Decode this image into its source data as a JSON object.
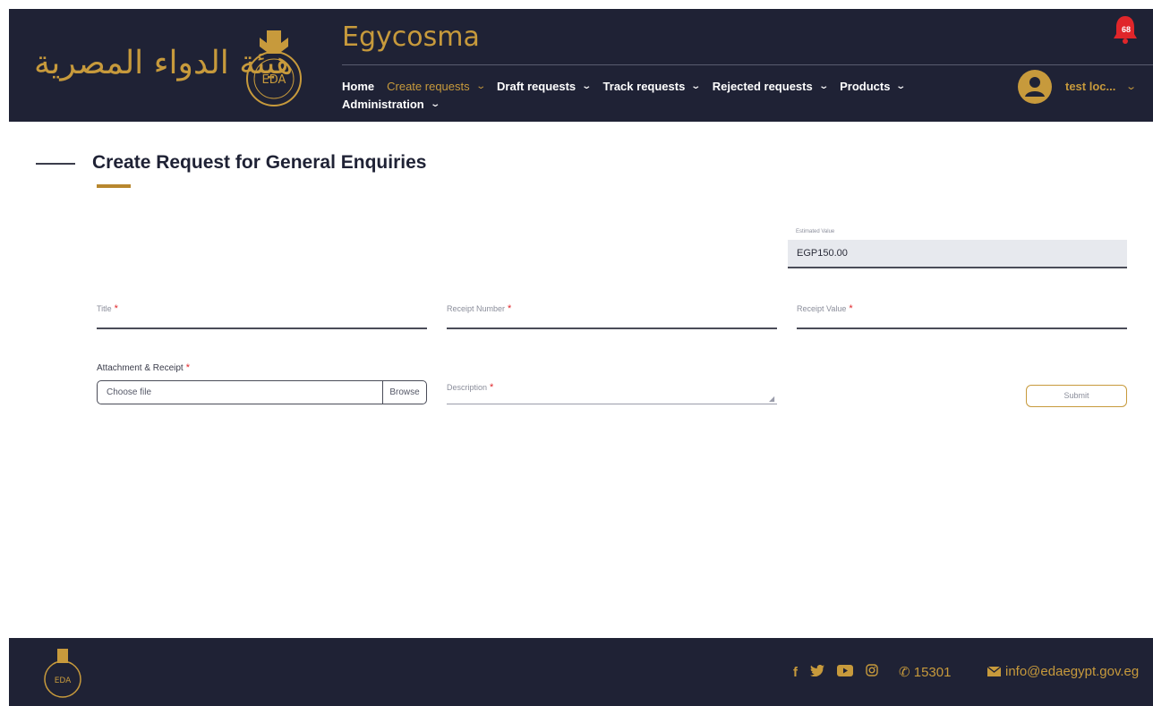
{
  "header": {
    "arabic_logo_text": "هيئة الدواء المصرية",
    "seal_text": "EDA",
    "app_title": "Egycosma",
    "notification_count": "68",
    "user_name": "test loc...",
    "nav": [
      {
        "label": "Home",
        "has_dropdown": false,
        "active": false
      },
      {
        "label": "Create requests",
        "has_dropdown": true,
        "active": true
      },
      {
        "label": "Draft requests",
        "has_dropdown": true,
        "active": false
      },
      {
        "label": "Track requests",
        "has_dropdown": true,
        "active": false
      },
      {
        "label": "Rejected requests",
        "has_dropdown": true,
        "active": false
      },
      {
        "label": "Products",
        "has_dropdown": true,
        "active": false
      },
      {
        "label": "Administration",
        "has_dropdown": true,
        "active": false
      }
    ]
  },
  "page": {
    "title": "Create Request for General Enquiries"
  },
  "form": {
    "estimated_value_label": "Estimated Value",
    "estimated_value": "EGP150.00",
    "title_label": "Title",
    "receipt_number_label": "Receipt Number",
    "receipt_value_label": "Receipt Value",
    "attachment_label": "Attachment & Receipt",
    "file_placeholder": "Choose file",
    "browse_label": "Browse",
    "description_label": "Description",
    "required_mark": "*",
    "submit_label": "Submit"
  },
  "footer": {
    "phone": "15301",
    "email": "info@edaegypt.gov.eg",
    "social_icons": [
      "facebook-icon",
      "twitter-icon",
      "youtube-icon",
      "instagram-icon"
    ]
  },
  "colors": {
    "navy": "#1f2235",
    "gold": "#c79a3c",
    "required": "#e0262a"
  }
}
